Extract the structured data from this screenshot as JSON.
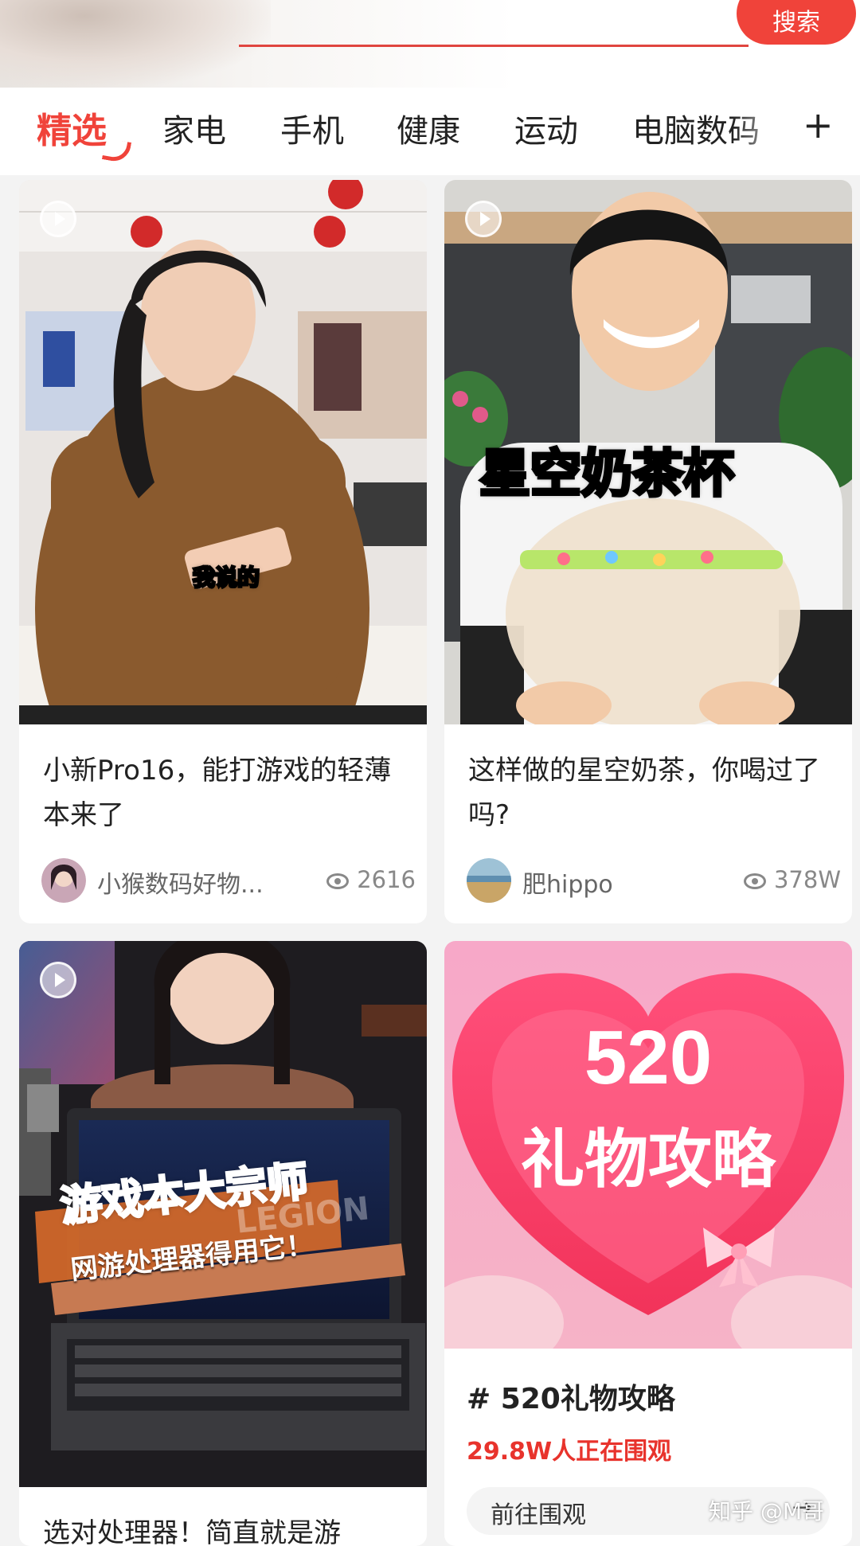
{
  "header": {
    "search_label": "搜索"
  },
  "tabs": {
    "items": [
      "精选",
      "家电",
      "手机",
      "健康",
      "运动",
      "电脑数码"
    ],
    "active": "精选",
    "add_icon": "plus-icon"
  },
  "cards": [
    {
      "thumb_caption": "我说的",
      "title": "小新Pro16，能打游戏的轻薄本来了",
      "author": "小猴数码好物...",
      "views": "2616",
      "has_video": true
    },
    {
      "thumb_caption": "星空奶茶杯",
      "title": "这样做的星空奶茶，你喝过了吗?",
      "author": "肥hippo",
      "views": "378W",
      "has_video": true
    },
    {
      "thumb_caption_1": "游戏本大宗师",
      "thumb_caption_2": "网游处理器得用它！",
      "thumb_logo": "LEGION",
      "title": "选对处理器！简直就是游",
      "has_video": true
    },
    {
      "thumb_number": "520",
      "thumb_caption": "礼物攻略",
      "topic": "# 520礼物攻略",
      "watching": "29.8W人正在围观",
      "action": "前往围观"
    }
  ],
  "watermark": "知乎 @M哥",
  "colors": {
    "accent": "#f0433a",
    "topic_red": "#e8332c"
  }
}
